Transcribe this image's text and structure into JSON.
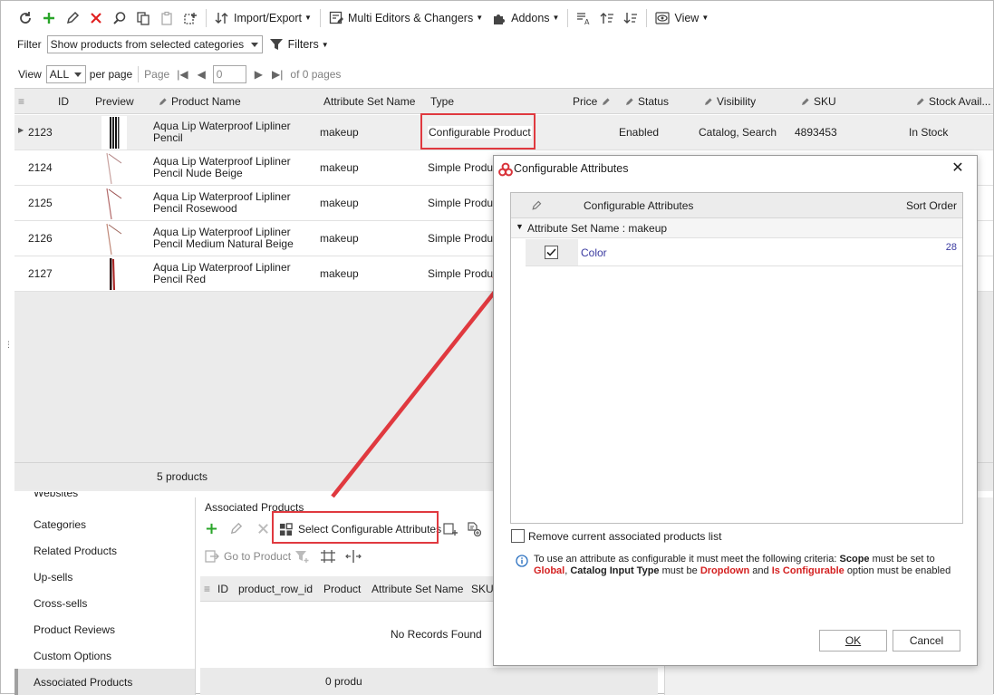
{
  "toolbar": {
    "import_export": "Import/Export",
    "multi_editors": "Multi Editors & Changers",
    "addons": "Addons",
    "view": "View"
  },
  "filter": {
    "label": "Filter",
    "value": "Show products from selected categories",
    "filters_label": "Filters"
  },
  "paging": {
    "view_label": "View",
    "view_value": "ALL",
    "per_page": "per page",
    "page_label": "Page",
    "page_value": "0",
    "of_pages": "of 0 pages"
  },
  "grid": {
    "headers": [
      "ID",
      "Preview",
      "Product Name",
      "Attribute Set Name",
      "Type",
      "Price",
      "Status",
      "Visibility",
      "SKU",
      "Stock Avail..."
    ],
    "rows": [
      {
        "id": "2123",
        "name1": "Aqua Lip Waterproof Lipliner",
        "name2": "Pencil",
        "attr": "makeup",
        "type": "Configurable Product",
        "status": "Enabled",
        "visibility": "Catalog, Search",
        "sku": "4893453",
        "stock": "In Stock"
      },
      {
        "id": "2124",
        "name1": "Aqua Lip Waterproof Lipliner",
        "name2": "Pencil Nude Beige",
        "attr": "makeup",
        "type": "Simple Produc"
      },
      {
        "id": "2125",
        "name1": "Aqua Lip Waterproof Lipliner",
        "name2": "Pencil Rosewood",
        "attr": "makeup",
        "type": "Simple Produc"
      },
      {
        "id": "2126",
        "name1": "Aqua Lip Waterproof Lipliner",
        "name2": "Pencil Medium Natural Beige",
        "attr": "makeup",
        "type": "Simple Produc"
      },
      {
        "id": "2127",
        "name1": "Aqua Lip Waterproof Lipliner",
        "name2": "Pencil Red",
        "attr": "makeup",
        "type": "Simple Produc"
      }
    ],
    "footer": "5 products"
  },
  "leftnav": {
    "items": [
      "Categories",
      "Related Products",
      "Up-sells",
      "Cross-sells",
      "Product Reviews",
      "Custom Options",
      "Associated Products"
    ]
  },
  "assoc": {
    "title": "Associated Products",
    "select_attrs": "Select Configurable Attributes",
    "go_to_product": "Go to Product",
    "headers": [
      "ID",
      "product_row_id",
      "Product",
      "Attribute Set Name",
      "SKU"
    ],
    "no_records": "No Records Found",
    "footer": "0 produ"
  },
  "dialog": {
    "title": "Configurable Attributes",
    "col_attrs": "Configurable Attributes",
    "col_sort": "Sort Order",
    "group": "Attribute Set Name : makeup",
    "row_attr": "Color",
    "row_sort": "28",
    "remove_label": "Remove current associated products list",
    "info_1": "To use an attribute as configurable it must meet the following criteria:",
    "info_scope": "Scope",
    "info_must_set": "must be set",
    "info_to": "to",
    "info_global": "Global",
    "info_catalog": "Catalog Input Type",
    "info_must_be": "must be",
    "info_dropdown": "Dropdown",
    "info_and": "and",
    "info_isconf": "Is Configurable",
    "info_option": "option must be",
    "info_enabled": "enabled",
    "ok": "OK",
    "cancel": "Cancel"
  },
  "colors": {
    "accent_red": "#e0393f",
    "link_blue": "#3a3aa0",
    "info_red": "#d42020",
    "add_green": "#2aa52a"
  }
}
